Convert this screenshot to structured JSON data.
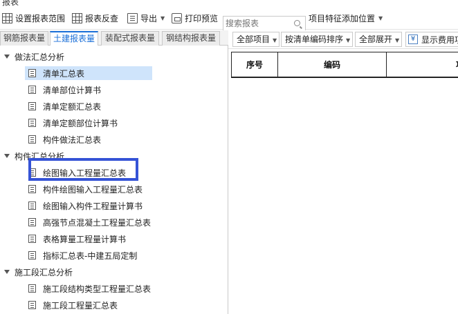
{
  "window": {
    "title": "报表"
  },
  "toolbar": {
    "set_range": "设置报表范围",
    "reverse_check": "报表反查",
    "export": "导出",
    "print_preview": "打印预览",
    "search_placeholder": "搜索报表",
    "add_feature_position": "项目特征添加位置"
  },
  "tabs": [
    "钢筋报表量",
    "土建报表量",
    "装配式报表量",
    "钢结构报表量"
  ],
  "active_tab": "土建报表量",
  "tree": {
    "group1": {
      "label": "做法汇总分析",
      "items": [
        "清单汇总表",
        "清单部位计算书",
        "清单定额汇总表",
        "清单定额部位计算书",
        "构件做法汇总表"
      ]
    },
    "group2": {
      "label": "构件汇总分析",
      "items": [
        "绘图输入工程量汇总表",
        "构件绘图输入工程量汇总表",
        "绘图输入构件工程量计算书",
        "高强节点混凝土工程量汇总表",
        "表格算量工程量计算书",
        "指标汇总表-中建五局定制"
      ]
    },
    "group3": {
      "label": "施工段汇总分析",
      "items": [
        "施工段结构类型工程量汇总表",
        "施工段工程量汇总表"
      ]
    },
    "selected_item": "清单汇总表",
    "highlighted_item": "绘图输入工程量汇总表"
  },
  "right_toolbar": {
    "all_items": "全部项目",
    "sort_by_code": "按清单编码排序",
    "expand_all": "全部展开",
    "show_fee": "显示费用项"
  },
  "table": {
    "columns": [
      "序号",
      "编码",
      "项"
    ]
  },
  "colors": {
    "accent": "#1a6fd8",
    "selection": "#cfe4fb",
    "highlight_box": "#3553d6"
  }
}
